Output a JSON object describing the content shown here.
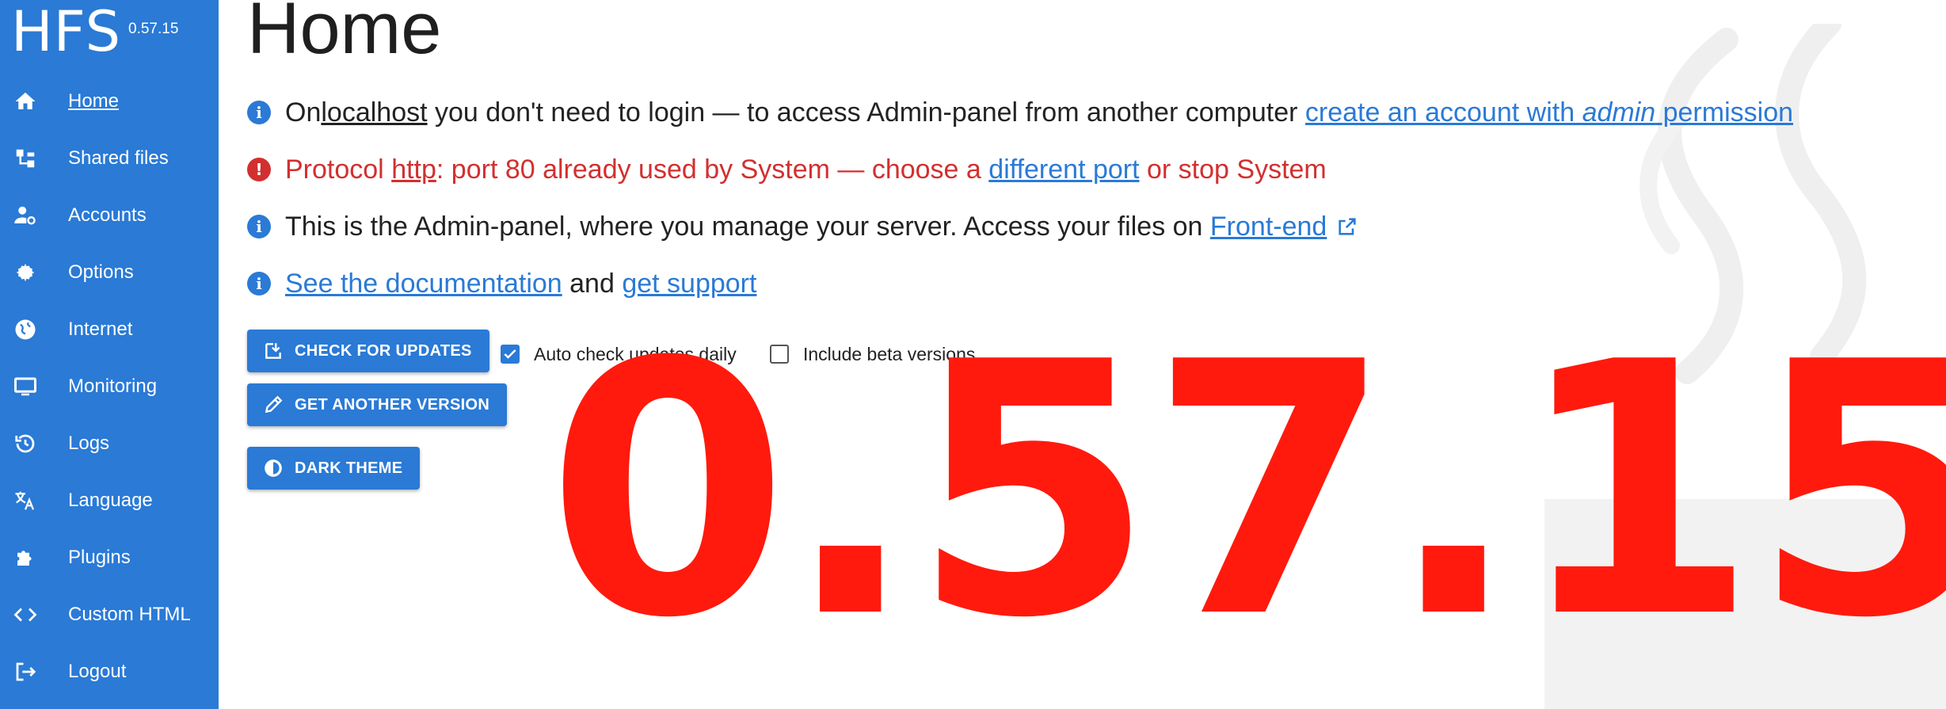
{
  "app": {
    "name": "HFS",
    "version": "0.57.15"
  },
  "sidebar": {
    "items": [
      {
        "label": "Home",
        "icon": "home-icon",
        "active": true
      },
      {
        "label": "Shared files",
        "icon": "shared-files-icon"
      },
      {
        "label": "Accounts",
        "icon": "accounts-icon"
      },
      {
        "label": "Options",
        "icon": "gear-icon"
      },
      {
        "label": "Internet",
        "icon": "globe-icon"
      },
      {
        "label": "Monitoring",
        "icon": "monitor-icon"
      },
      {
        "label": "Logs",
        "icon": "history-icon"
      },
      {
        "label": "Language",
        "icon": "translate-icon"
      },
      {
        "label": "Plugins",
        "icon": "puzzle-icon"
      },
      {
        "label": "Custom HTML",
        "icon": "code-icon"
      },
      {
        "label": "Logout",
        "icon": "logout-icon"
      }
    ]
  },
  "main": {
    "title": "Home",
    "messages": {
      "login": {
        "pre": "On ",
        "localhost": "localhost",
        "mid": " you don't need to login — to access Admin-panel from another computer ",
        "link_a": "create an account with ",
        "link_em": "admin",
        "link_b": " permission"
      },
      "protocol": {
        "pre": "Protocol ",
        "http": "http",
        "mid": ": port 80 already used by System — choose a ",
        "link": "different port",
        "post": " or stop System"
      },
      "frontend": {
        "pre": "This is the Admin-panel, where you manage your server. Access your files on ",
        "link": "Front-end"
      },
      "docs": {
        "link_docs": "See the documentation",
        "mid": " and ",
        "link_support": "get support"
      }
    },
    "buttons": {
      "check_updates": "CHECK FOR UPDATES",
      "another_version": "GET ANOTHER VERSION",
      "dark_theme": "DARK THEME"
    },
    "checkboxes": {
      "auto_check": {
        "label": "Auto check updates daily",
        "checked": true
      },
      "beta": {
        "label": "Include beta versions",
        "checked": false
      }
    },
    "overlay_version": "0.57.15"
  },
  "colors": {
    "accent": "#2a7ad6",
    "error": "#d32f2f",
    "overlay": "#ff1a0d"
  }
}
